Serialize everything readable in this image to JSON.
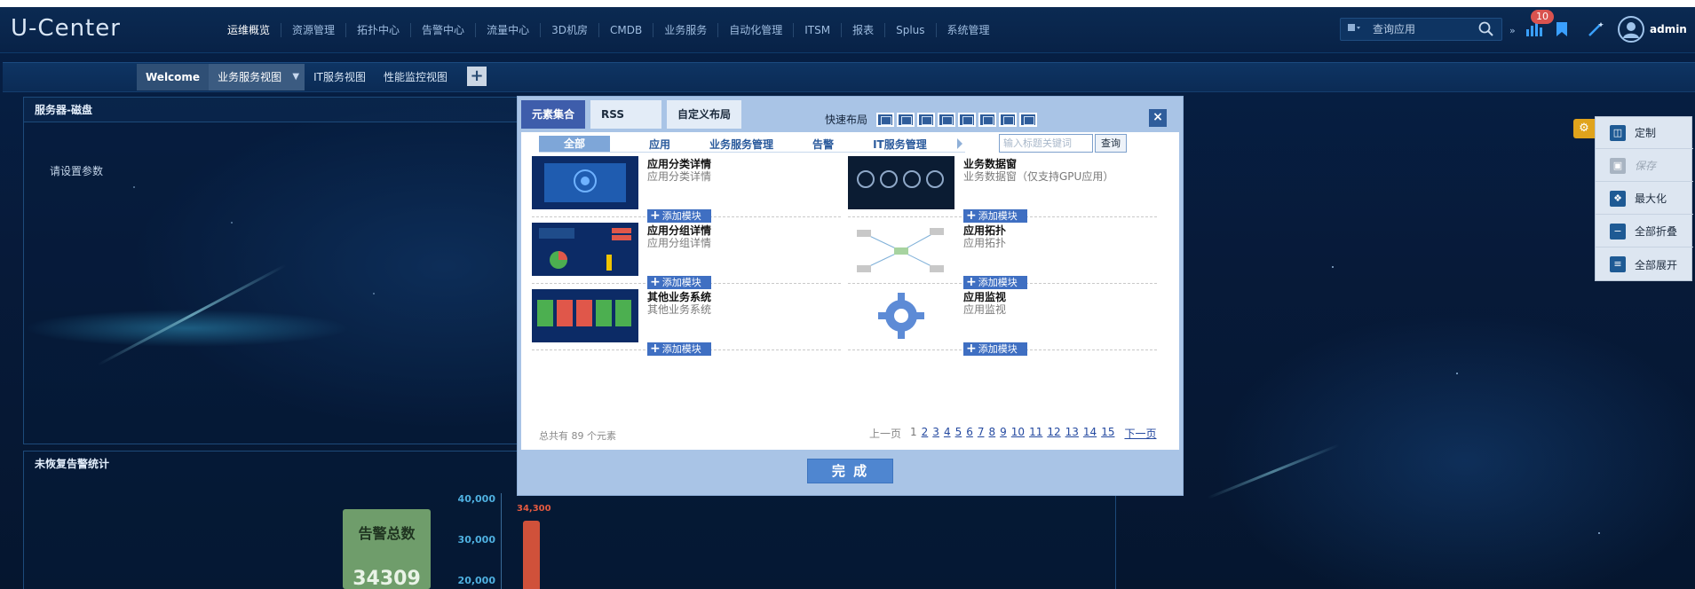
{
  "app": {
    "logo": "U-Center"
  },
  "nav": {
    "items": [
      "运维概览",
      "资源管理",
      "拓扑中心",
      "告警中心",
      "流量中心",
      "3D机房",
      "CMDB",
      "业务服务",
      "自动化管理",
      "ITSM",
      "报表",
      "Splus",
      "系统管理"
    ],
    "active_index": 0
  },
  "header": {
    "search_placeholder": "查询应用",
    "badge_count": "10",
    "username": "admin"
  },
  "views": {
    "items": [
      "Welcome",
      "业务服务视图",
      "IT服务视图",
      "性能监控视图"
    ],
    "active_index": 1,
    "add_label": "+"
  },
  "panels": {
    "disk": {
      "title": "服务器-磁盘",
      "message": "请设置参数"
    },
    "alarm": {
      "title": "未恢复告警统计",
      "card_title": "告警总数",
      "card_value": "34309",
      "chart_data": {
        "type": "bar",
        "yticks": [
          "40,000",
          "30,000",
          "20,000"
        ],
        "values": [
          34300
        ],
        "data_labels": [
          "34,300"
        ]
      }
    }
  },
  "side_menu": {
    "items": [
      {
        "label": "定制",
        "icon": "layout-icon",
        "enabled": true
      },
      {
        "label": "保存",
        "icon": "save-icon",
        "enabled": false
      },
      {
        "label": "最大化",
        "icon": "maximize-icon",
        "enabled": true
      },
      {
        "label": "全部折叠",
        "icon": "collapse-icon",
        "enabled": true
      },
      {
        "label": "全部展开",
        "icon": "expand-icon",
        "enabled": true
      }
    ]
  },
  "modal": {
    "tabs": [
      "元素集合",
      "RSS",
      "自定义布局"
    ],
    "active_tab": 0,
    "quick_layout_label": "快速布局",
    "categories": [
      "全部",
      "应用",
      "业务服务管理",
      "告警",
      "IT服务管理"
    ],
    "keyword_placeholder": "输入标题关键词",
    "query_label": "查询",
    "add_label": "添加模块",
    "elements": [
      {
        "name": "应用分类详情",
        "desc": "应用分类详情"
      },
      {
        "name": "业务数据窗",
        "desc": "业务数据窗（仅支持GPU应用）"
      },
      {
        "name": "应用分组详情",
        "desc": "应用分组详情"
      },
      {
        "name": "应用拓扑",
        "desc": "应用拓扑"
      },
      {
        "name": "其他业务系统",
        "desc": "其他业务系统"
      },
      {
        "name": "应用监视",
        "desc": "应用监视"
      }
    ],
    "total_text": "总共有 89 个元素",
    "pager": {
      "prev": "上一页",
      "pages": [
        "1",
        "2",
        "3",
        "4",
        "5",
        "6",
        "7",
        "8",
        "9",
        "10",
        "11",
        "12",
        "13",
        "14",
        "15"
      ],
      "current": "1",
      "next": "下一页"
    },
    "done_label": "完 成"
  },
  "colors": {
    "accent": "#3e5dab",
    "bar": "#d0513a",
    "alarm_card": "#6f9d6b",
    "badge": "#d9534f"
  }
}
